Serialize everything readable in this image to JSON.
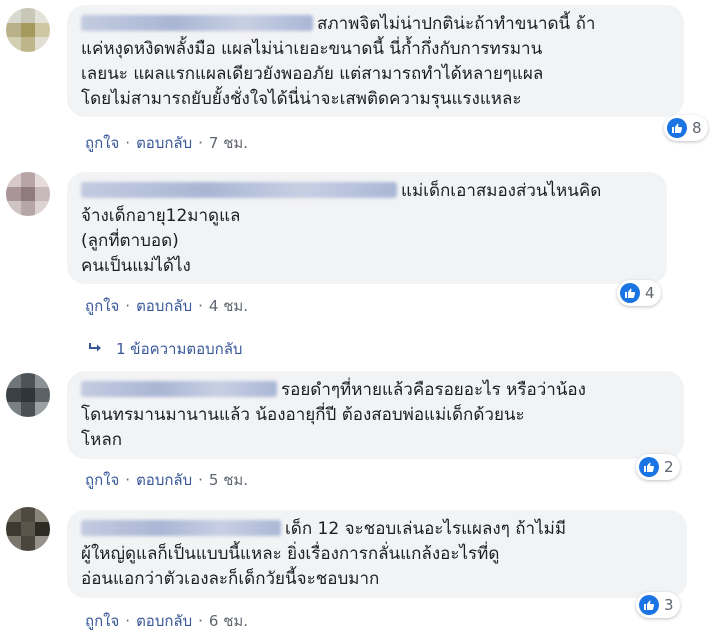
{
  "actions": {
    "like": "ถูกใจ",
    "reply": "ตอบกลับ",
    "separator": "·"
  },
  "comments": [
    {
      "lines": [
        "สภาพจิตไม่น่าปกติน่ะถ้าทำขนาดนี้ ถ้า",
        "แค่หงุดหงิดพลั้งมือ แผลไม่น่าเยอะขนาดนี้ นี่ก้ำกึ่งกับการทรมาน",
        "เลยนะ แผลแรกแผลเดียวยังพออภัย แต่สามารถทำได้หลายๆแผล",
        "โดยไม่สามารถยับยั้งชั่งใจได้นี่น่าจะเสพติดความรุนแรงแหละ"
      ],
      "reactions": "8",
      "time": "7 ชม.",
      "avatar_colors": [
        "#d8d9cf",
        "#c9c7b5",
        "#e4e3da",
        "#b9b18a",
        "#a59a5e",
        "#cfc7a3",
        "#d3cfb3",
        "#bfb58b",
        "#e1dfd2"
      ]
    },
    {
      "lines": [
        "แม่เด็กเอาสมองส่วนไหนคิด",
        "จ้างเด็กอายุ12มาดูแล",
        "(ลูกที่ตาบอด)",
        "คนเป็นแม่ได้ไง"
      ],
      "reactions": "4",
      "time": "4 ชม.",
      "avatar_colors": [
        "#d7c9c9",
        "#b7a4a6",
        "#e6dada",
        "#a9949a",
        "#8f7a7f",
        "#c8b9bb",
        "#cfc4c4",
        "#b5a6a8",
        "#ddd3d3"
      ]
    },
    {
      "lines": [
        "รอยดำๆที่หายแล้วคือรอยอะไร หรือว่าน้อง",
        "โดนทรมานมานานแล้ว น้องอายุกี่ปี ต้องสอบพ่อแม่เด็กด้วยนะ",
        "โหลก"
      ],
      "reactions": "2",
      "time": "5 ชม.",
      "avatar_colors": [
        "#6f767a",
        "#4d5458",
        "#8b9296",
        "#3a4145",
        "#2f3538",
        "#5c6367",
        "#7a8185",
        "#4a5155",
        "#9aa0a3"
      ]
    },
    {
      "lines": [
        "เด็ก 12 จะชอบเล่นอะไรแผลงๆ ถ้าไม่มี",
        "ผู้ใหญ่ดูแลก็เป็นแบบนี้แหละ ยิ่งเรื่องการกลั่นแกล้งอะไรที่ดู",
        "อ่อนแอกว่าตัวเองละก็เด็กวัยนี้จะชอบมาก"
      ],
      "reactions": "3",
      "time": "6 ชม.",
      "avatar_colors": [
        "#6e6a60",
        "#4f4a40",
        "#8a857a",
        "#3d3830",
        "#5a554b",
        "#2e2a24",
        "#7a766c",
        "#4a463e",
        "#96918a"
      ]
    }
  ],
  "replies_link": "1 ข้อความตอบกลับ"
}
